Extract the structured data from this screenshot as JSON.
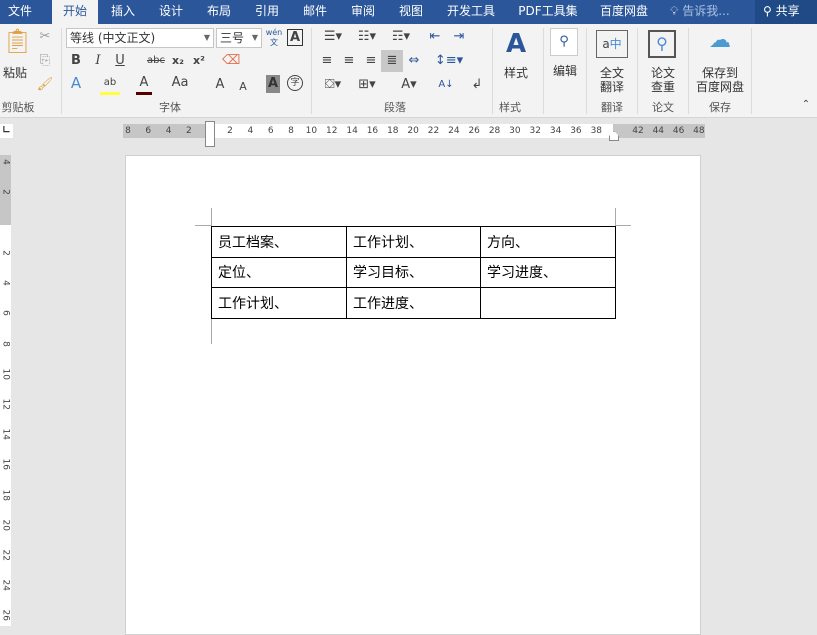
{
  "tabs": [
    {
      "label": "文件"
    },
    {
      "label": "开始"
    },
    {
      "label": "插入"
    },
    {
      "label": "设计"
    },
    {
      "label": "布局"
    },
    {
      "label": "引用"
    },
    {
      "label": "邮件"
    },
    {
      "label": "审阅"
    },
    {
      "label": "视图"
    },
    {
      "label": "开发工具"
    },
    {
      "label": "PDF工具集"
    },
    {
      "label": "百度网盘"
    }
  ],
  "active_tab": "开始",
  "tell_me": "告诉我...",
  "share": "共享",
  "ribbon": {
    "clipboard": {
      "paste": "粘贴",
      "label": "剪贴板"
    },
    "font": {
      "name": "等线 (中文正文)",
      "size": "三号",
      "label": "字体",
      "pinyin": "wén",
      "pinyin_char": "文",
      "bold": "B",
      "italic": "I",
      "underline": "U",
      "strike": "abc",
      "sub": "x₂",
      "sup": "x²",
      "case": "Aa",
      "grow": "A",
      "shrink": "A",
      "shade": "A",
      "enclose": "字"
    },
    "paragraph": {
      "label": "段落"
    },
    "styles": {
      "button": "样式",
      "label": "样式"
    },
    "edit": {
      "button": "编辑"
    },
    "translate": {
      "button_line1": "全文",
      "button_line2": "翻译",
      "label": "翻译"
    },
    "paper": {
      "button_line1": "论文",
      "button_line2": "查重",
      "label": "论文"
    },
    "save": {
      "button_line1": "保存到",
      "button_line2": "百度网盘",
      "label": "保存"
    }
  },
  "ruler": {
    "left": [
      "8",
      "6",
      "4",
      "2"
    ],
    "main": [
      "2",
      "4",
      "6",
      "8",
      "10",
      "12",
      "14",
      "16",
      "18",
      "20",
      "22",
      "24",
      "26",
      "28",
      "30",
      "32",
      "34",
      "36",
      "38"
    ],
    "right": [
      "42",
      "44",
      "46",
      "48"
    ]
  },
  "vruler": {
    "top": [
      "4",
      "2"
    ],
    "main": [
      "2",
      "4",
      "6",
      "8",
      "10",
      "12",
      "14",
      "16",
      "18",
      "20",
      "22",
      "24",
      "26"
    ]
  },
  "table": [
    [
      "员工档案、",
      "工作计划、",
      "方向、"
    ],
    [
      "定位、",
      "学习目标、",
      "学习进度、"
    ],
    [
      "工作计划、",
      "工作进度、",
      ""
    ]
  ],
  "colors": {
    "accent": "#2b579a",
    "ribbon": "#f3f3f3"
  }
}
